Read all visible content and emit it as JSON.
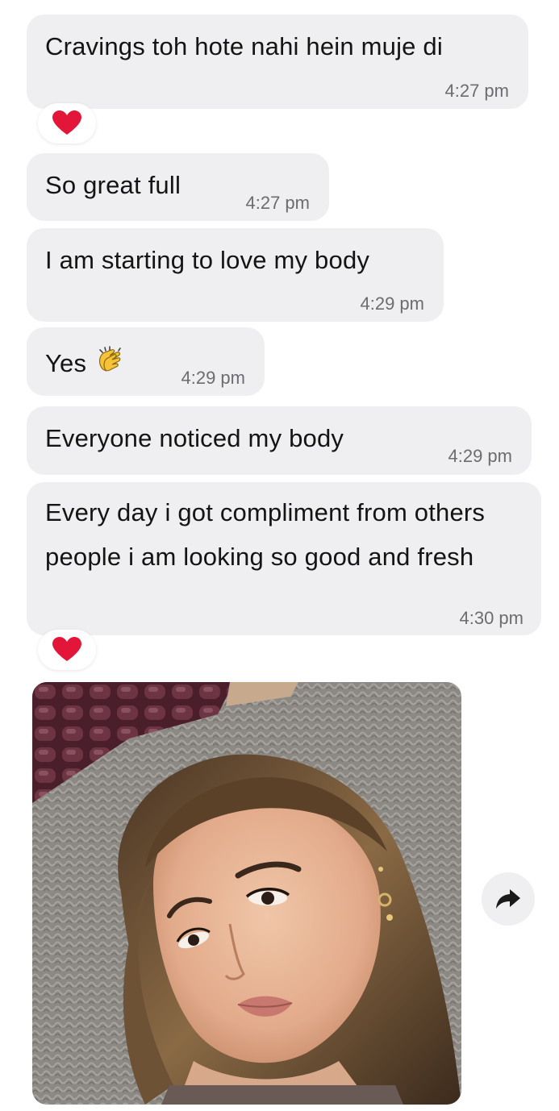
{
  "messages": [
    {
      "text": "Cravings toh hote nahi hein muje di",
      "time": "4:27 pm",
      "reaction": "heart"
    },
    {
      "text": "So great full",
      "time": "4:27 pm"
    },
    {
      "text": "I am starting to love my body",
      "time": "4:29 pm"
    },
    {
      "text": "Yes",
      "emoji": "clapping-hands",
      "time": "4:29 pm"
    },
    {
      "text": "Everyone noticed my body",
      "time": "4:29 pm"
    },
    {
      "text": "Every day i got compliment from others people i am looking so good and fresh",
      "time": "4:30 pm",
      "reaction": "heart"
    }
  ],
  "attachment": {
    "type": "photo",
    "subject": "selfie"
  },
  "forward_button": {
    "icon": "forward-arrow-icon"
  },
  "colors": {
    "bubble": "#efeff1",
    "reaction_heart": "#e3163a",
    "timestamp": "#6c6c70"
  }
}
